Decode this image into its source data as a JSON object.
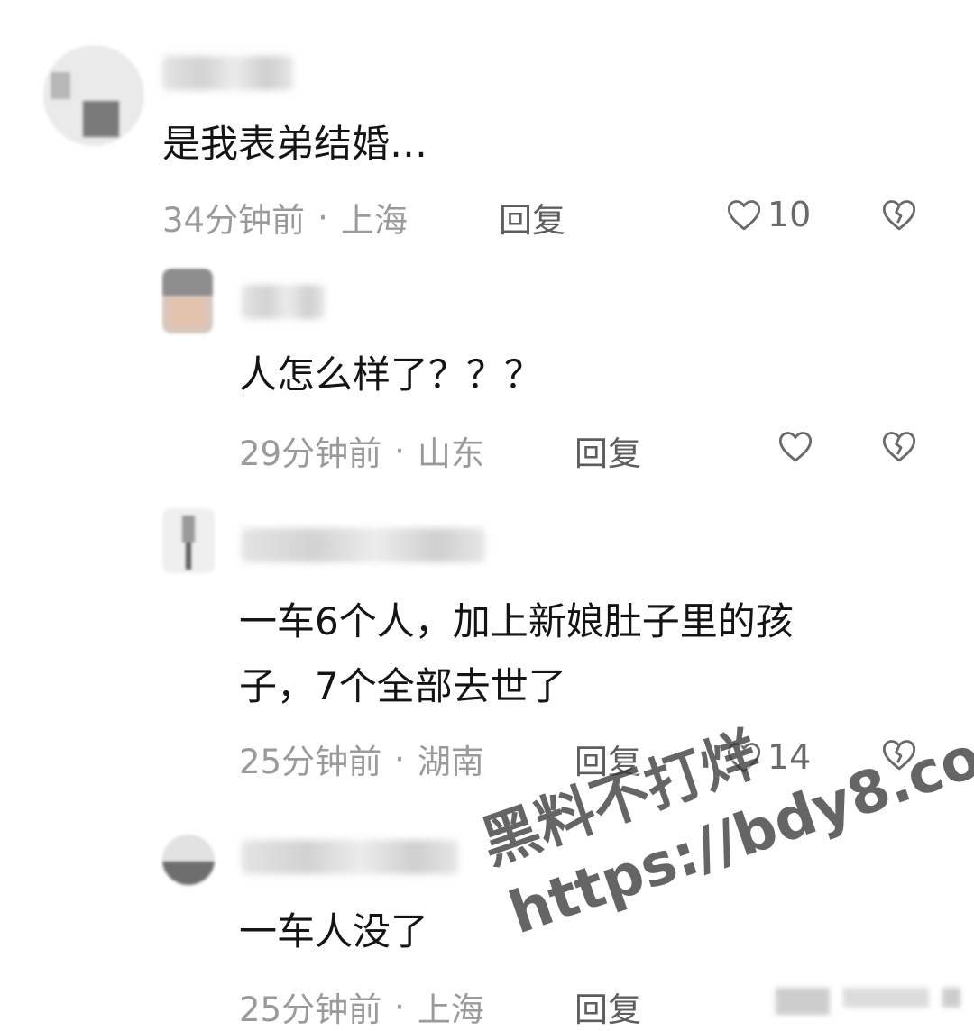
{
  "comments": [
    {
      "text": "是我表弟结婚…",
      "time": "34分钟前",
      "sep": "·",
      "location": "上海",
      "reply_label": "回复",
      "like_count": "10"
    },
    {
      "text": "人怎么样了？？？",
      "time": "29分钟前",
      "sep": "·",
      "location": "山东",
      "reply_label": "回复",
      "like_count": ""
    },
    {
      "text_line1": "一车6个人，加上新娘肚子里的孩",
      "text_line2": "子，7个全部去世了",
      "time": "25分钟前",
      "sep": "·",
      "location": "湖南",
      "reply_label": "回复",
      "like_count": "14"
    },
    {
      "text": "一车人没了",
      "time": "25分钟前",
      "sep": "·",
      "location": "上海",
      "reply_label": "回复",
      "like_count": ""
    }
  ],
  "watermark": {
    "line1": "黑料不打烊",
    "line2": "https://bdy8.co"
  },
  "icons": {
    "like": "heart-outline-icon",
    "dislike": "broken-heart-icon"
  },
  "colors": {
    "text": "#141414",
    "meta": "#9a9a9a",
    "reply": "#5e5e5e",
    "icon": "#6a6a6a"
  }
}
